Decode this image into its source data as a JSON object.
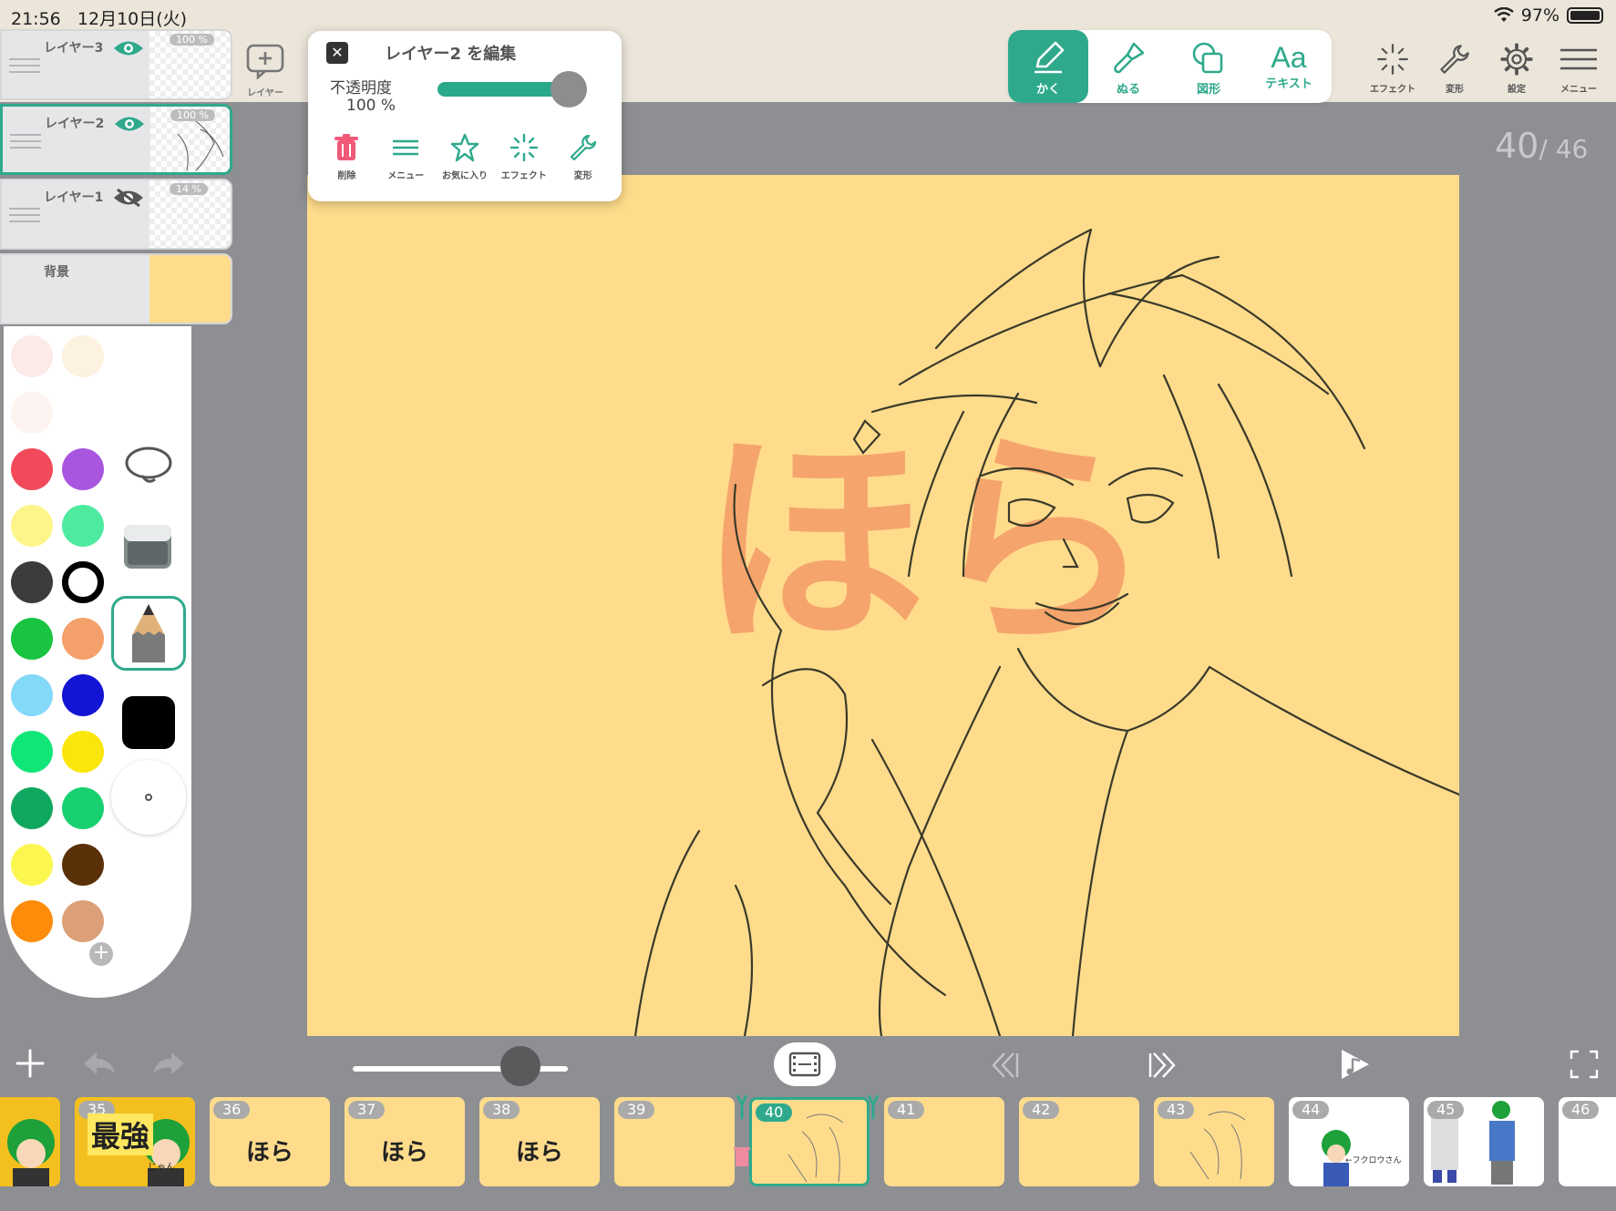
{
  "status": {
    "time": "21:56",
    "date": "12月10日(火)",
    "battery": "97%"
  },
  "layers": [
    {
      "name": "レイヤー3",
      "opacity": "100 %",
      "visible": true,
      "selected": false
    },
    {
      "name": "レイヤー2",
      "opacity": "100 %",
      "visible": true,
      "selected": true
    },
    {
      "name": "レイヤー1",
      "opacity": "14 %",
      "visible": false,
      "selected": false
    },
    {
      "name": "背景",
      "background": true
    }
  ],
  "add_layer_label": "レイヤー",
  "popup": {
    "title": "レイヤー2 を編集",
    "opacity_label": "不透明度",
    "opacity_value": "100 %",
    "opacity_level": 1.0,
    "actions": [
      "削除",
      "メニュー",
      "お気に入り",
      "エフェクト",
      "変形"
    ]
  },
  "tool_tabs": [
    {
      "label": "かく",
      "icon": "pen-icon",
      "active": true
    },
    {
      "label": "ぬる",
      "icon": "brush-icon",
      "active": false
    },
    {
      "label": "図形",
      "icon": "shapes-icon",
      "active": false
    },
    {
      "label": "テキスト",
      "glyph": "Aa",
      "icon": "text-icon",
      "active": false
    }
  ],
  "right_tools": [
    "エフェクト",
    "変形",
    "設定",
    "メニュー"
  ],
  "frame_counter": {
    "current": "40",
    "total": "/ 46"
  },
  "canvas_text": "ほら",
  "palette": {
    "colors": [
      "#fbe8e4",
      "#fdf0dc",
      "#fdf2ee",
      "#ffffff",
      "#f24a5a",
      "#a855e0",
      "#fdf58a",
      "#4eeaa0",
      "#3c3c3c",
      "#ffffff",
      "#18c440",
      "#f4a06a",
      "#84d8f8",
      "#1414d4",
      "#10e678",
      "#fae60a",
      "#10a860",
      "#18d070",
      "#fcf650",
      "#5a3008",
      "#fc8c0a",
      "#dca078"
    ],
    "accent": "#2fa98c"
  },
  "timeline": {
    "speed_level": 0.78,
    "frames": [
      {
        "num": "",
        "kind": "art-green"
      },
      {
        "num": "35",
        "kind": "art-big",
        "text": "最強",
        "small": "じゃん"
      },
      {
        "num": "36",
        "text": "ほら"
      },
      {
        "num": "37",
        "text": "ほら"
      },
      {
        "num": "38",
        "text": "ほら"
      },
      {
        "num": "39",
        "text": ""
      },
      {
        "num": "40",
        "text": "",
        "selected": true,
        "sketch": true
      },
      {
        "num": "41",
        "text": ""
      },
      {
        "num": "42",
        "text": ""
      },
      {
        "num": "43",
        "text": "",
        "sketch": true
      },
      {
        "num": "44",
        "white": true,
        "note": "←フクロウさん"
      },
      {
        "num": "45",
        "white": true
      },
      {
        "num": "46",
        "white": true
      }
    ]
  }
}
